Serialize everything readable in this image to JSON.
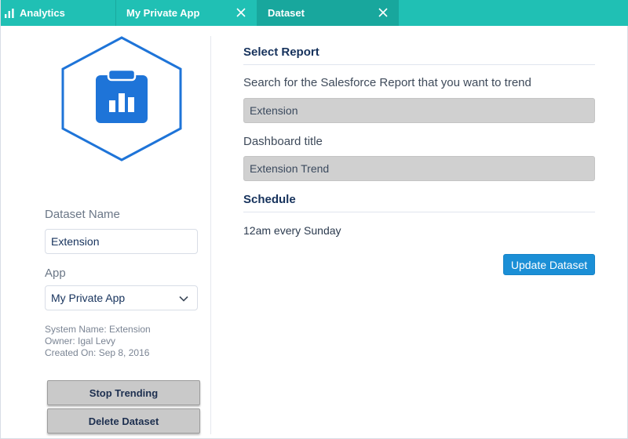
{
  "tabs": [
    {
      "label": "Analytics",
      "icon": "bar-chart-icon"
    },
    {
      "label": "My Private App",
      "close_icon": "close-icon"
    },
    {
      "label": "Dataset",
      "close_icon": "close-icon",
      "active": true
    }
  ],
  "colors": {
    "tabbar": "#20c0b4",
    "active_tab": "#18a79d",
    "accent": "#1b8fd6",
    "icon_blue": "#1e74d8"
  },
  "left_panel": {
    "icon": "clipboard-chart-icon",
    "dataset_name_label": "Dataset Name",
    "dataset_name_value": "Extension",
    "app_label": "App",
    "app_selected": "My Private App",
    "system_name": "System Name: Extension",
    "owner": "Owner: Igal Levy",
    "created_on": "Created On: Sep 8, 2016",
    "stop_trending_label": "Stop Trending",
    "delete_dataset_label": "Delete Dataset"
  },
  "right_panel": {
    "select_report_title": "Select Report",
    "search_label": "Search for the Salesforce Report that you want to trend",
    "search_value": "Extension",
    "dashboard_title_label": "Dashboard title",
    "dashboard_title_value": "Extension Trend",
    "schedule_title": "Schedule",
    "schedule_value": "12am every Sunday",
    "update_button_label": "Update Dataset"
  }
}
